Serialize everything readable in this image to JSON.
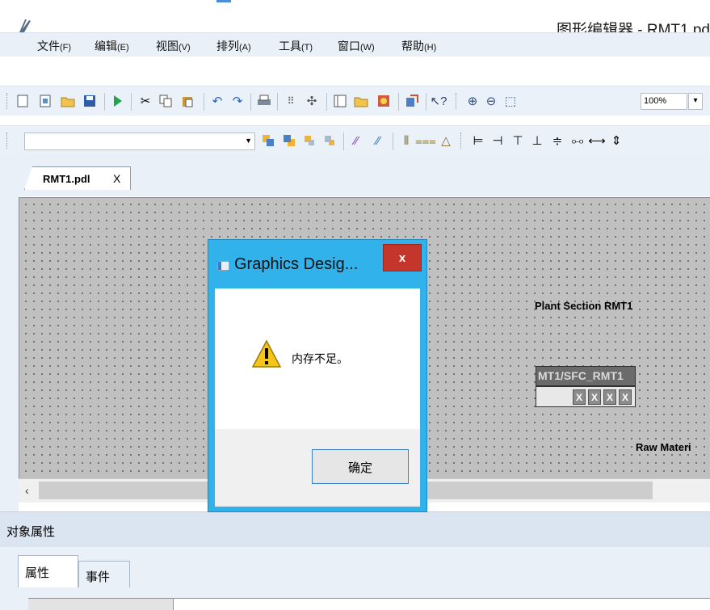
{
  "window": {
    "title": "图形编辑器 - RMT1.pd"
  },
  "menu": [
    {
      "label": "文件",
      "key": "(F)"
    },
    {
      "label": "编辑",
      "key": "(E)"
    },
    {
      "label": "视图",
      "key": "(V)"
    },
    {
      "label": "排列",
      "key": "(A)"
    },
    {
      "label": "工具",
      "key": "(T)"
    },
    {
      "label": "窗口",
      "key": "(W)"
    },
    {
      "label": "帮助",
      "key": "(H)"
    }
  ],
  "toolbar": {
    "zoom": "100%"
  },
  "tab": {
    "label": "RMT1.pdl",
    "close": "X"
  },
  "canvas": {
    "plant_label": "Plant Section RMT1",
    "sfc_label": "MT1/SFC_RMT1",
    "sfc_cells": [
      "X",
      "X",
      "X",
      "X"
    ],
    "raw_label": "Raw Materi"
  },
  "properties": {
    "header": "对象属性",
    "tabs": [
      "属性",
      "事件"
    ]
  },
  "dialog": {
    "title": "Graphics Desig...",
    "close": "x",
    "message": "内存不足。",
    "ok": "确定"
  },
  "colors": {
    "dialog_frame": "#32b2ea",
    "close_button": "#c4362c",
    "canvas": "#c0c0c0"
  }
}
